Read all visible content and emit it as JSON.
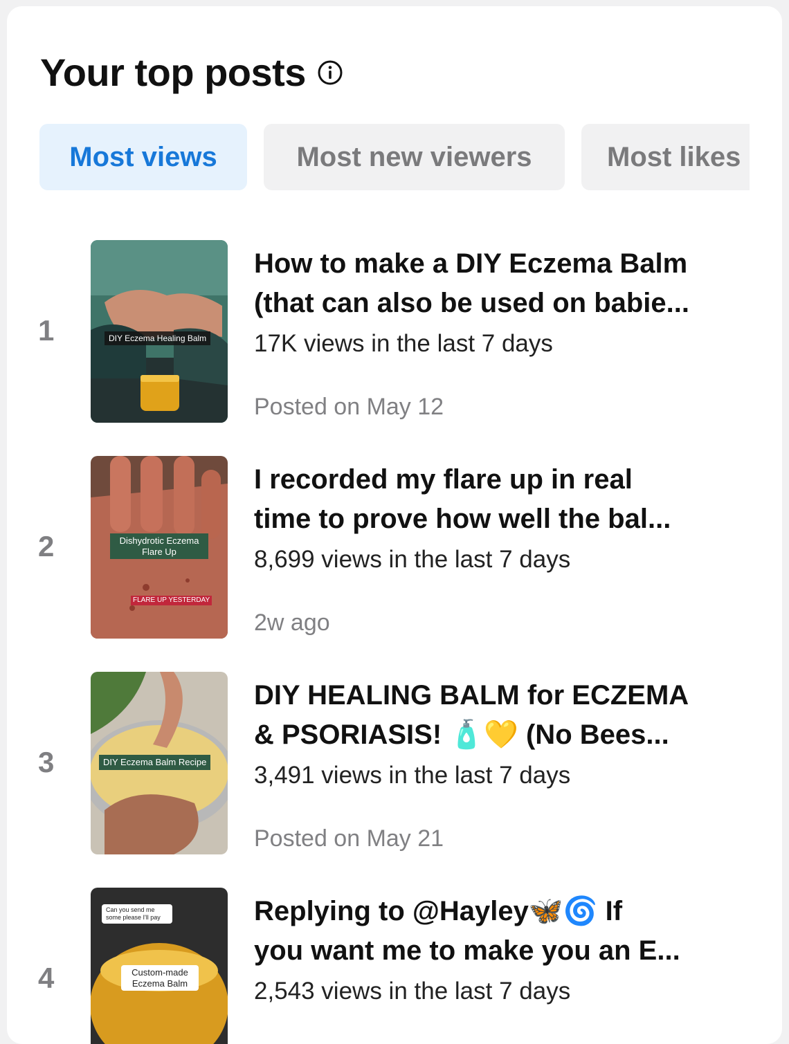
{
  "header": {
    "title": "Your top posts",
    "info_icon": "info-icon"
  },
  "tabs": [
    {
      "label": "Most views",
      "active": true
    },
    {
      "label": "Most new viewers",
      "active": false
    },
    {
      "label": "Most likes",
      "active": false
    }
  ],
  "posts": [
    {
      "rank": "1",
      "title_line1": "How to make a DIY Eczema Balm",
      "title_line2": "(that can also be used on babie...",
      "views": "17K views in the last 7 days",
      "posted": "Posted on May 12",
      "thumb_label": "DIY Eczema Healing Balm"
    },
    {
      "rank": "2",
      "title_line1": "I recorded my flare up in real",
      "title_line2": "time to prove how well the bal...",
      "views": "8,699 views in the last 7 days",
      "posted": "2w ago",
      "thumb_label": "Dishydrotic Eczema Flare Up",
      "thumb_label2": "FLARE UP YESTERDAY"
    },
    {
      "rank": "3",
      "title_line1": "DIY HEALING BALM for ECZEMA",
      "title_line2": "& PSORIASIS! 🧴💛 (No Bees...",
      "views": "3,491 views in the last 7 days",
      "posted": "Posted on May 21",
      "thumb_label": "DIY Eczema Balm Recipe"
    },
    {
      "rank": "4",
      "title_line1": "Replying to @Hayley🦋🌀  If",
      "title_line2": "you want me to make you an E...",
      "views": "2,543 views in the last 7 days",
      "posted": "",
      "thumb_label": "Custom-made Eczema Balm",
      "thumb_comment": "Can you send me some please I'll pay"
    }
  ],
  "colors": {
    "accent": "#1778d9",
    "accent_bg": "#e6f2fd",
    "tab_bg": "#f1f1f2",
    "muted": "#808083"
  }
}
